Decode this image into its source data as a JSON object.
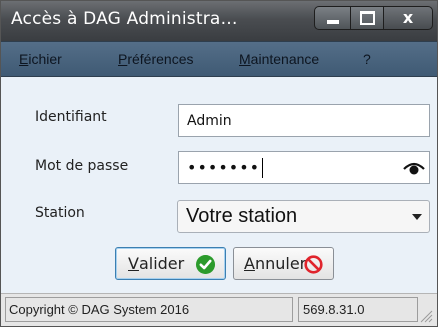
{
  "window": {
    "title": "Accès à DAG Administra…",
    "controls": {
      "minimize": "minimize-icon",
      "maximize": "maximize-icon",
      "close": "x"
    }
  },
  "menu": {
    "items": [
      {
        "first": "E",
        "rest": "ichier"
      },
      {
        "first": "P",
        "rest": "références"
      },
      {
        "first": "M",
        "rest": "aintenance"
      },
      {
        "first": "",
        "rest": "?"
      }
    ]
  },
  "form": {
    "identifiant_label": "Identifiant",
    "identifiant_value": "Admin",
    "password_label": "Mot de passe",
    "password_masked": "•••••••",
    "password_toggle_icon": "eye-icon",
    "station_label": "Station",
    "station_value": "Votre station"
  },
  "buttons": {
    "ok_first": "V",
    "ok_rest": "alider",
    "ok_icon": "check-icon",
    "cancel_first": "A",
    "cancel_rest": "nnuler",
    "cancel_icon": "no-sign-icon"
  },
  "status": {
    "copyright": "Copyright © DAG System 2016",
    "version": "569.8.31.0"
  },
  "colors": {
    "titlebar": "#4a4d51",
    "menubar": "#4a6581",
    "ok_icon": "#2c9b2c",
    "cancel_icon": "#e0242c"
  }
}
